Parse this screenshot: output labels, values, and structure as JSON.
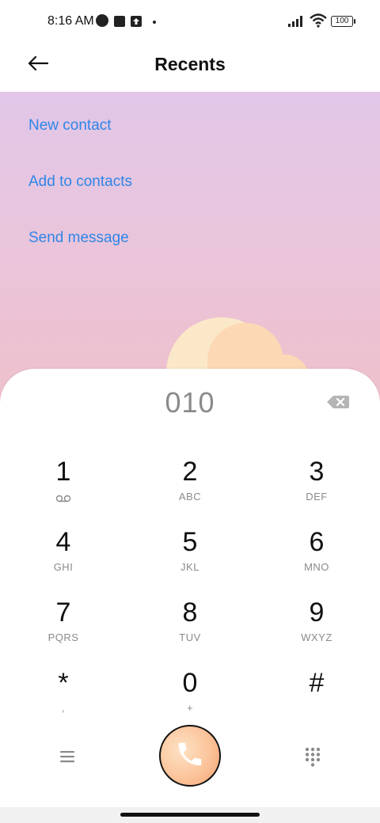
{
  "status_bar": {
    "time": "8:16 AM",
    "battery": "100"
  },
  "header": {
    "title": "Recents"
  },
  "actions": {
    "new_contact": "New contact",
    "add_to_contacts": "Add to contacts",
    "send_message": "Send message"
  },
  "dialer": {
    "number": "010",
    "keys": [
      {
        "digit": "1",
        "letters": ""
      },
      {
        "digit": "2",
        "letters": "ABC"
      },
      {
        "digit": "3",
        "letters": "DEF"
      },
      {
        "digit": "4",
        "letters": "GHI"
      },
      {
        "digit": "5",
        "letters": "JKL"
      },
      {
        "digit": "6",
        "letters": "MNO"
      },
      {
        "digit": "7",
        "letters": "PQRS"
      },
      {
        "digit": "8",
        "letters": "TUV"
      },
      {
        "digit": "9",
        "letters": "WXYZ"
      },
      {
        "digit": "*",
        "letters": ","
      },
      {
        "digit": "0",
        "letters": "+"
      },
      {
        "digit": "#",
        "letters": ""
      }
    ]
  },
  "icons": {
    "back": "arrow-left-icon",
    "backspace": "backspace-icon",
    "voicemail": "voicemail-icon",
    "menu": "menu-icon",
    "call": "phone-icon",
    "keypad": "dialpad-icon"
  },
  "colors": {
    "link": "#2f86e8",
    "gradient_top": "#e1c6e8",
    "gradient_bottom": "#efc0cb",
    "call_button": "#fbc49b"
  }
}
